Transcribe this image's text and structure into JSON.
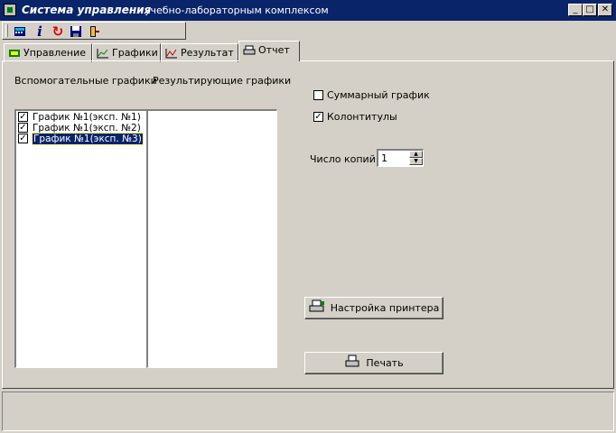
{
  "window": {
    "title_main": "Система управления",
    "title_sub": "учебно-лабораторным комплексом",
    "controls": {
      "minimize": "_",
      "maximize": "□",
      "close": "✕"
    }
  },
  "toolbar": {
    "buttons": [
      {
        "icon": "calculator-icon"
      },
      {
        "icon": "info-icon",
        "glyph": "i"
      },
      {
        "icon": "refresh-icon",
        "glyph": "↻"
      },
      {
        "icon": "save-icon"
      },
      {
        "icon": "exit-icon"
      }
    ]
  },
  "tabs": [
    {
      "label": "Управление",
      "icon": "control-icon"
    },
    {
      "label": "Графики",
      "icon": "chart-icon"
    },
    {
      "label": "Результат",
      "icon": "result-chart-icon"
    },
    {
      "label": "Отчет",
      "icon": "printer-icon",
      "active": true
    }
  ],
  "report": {
    "aux_label": "Вспомогательные графики",
    "result_label": "Результирующие графики",
    "aux_items": [
      {
        "label": "График №1(эксп. №1)",
        "checked": true
      },
      {
        "label": "График №1(эксп. №2)",
        "checked": true
      },
      {
        "label": "График №1(эксп. №3)",
        "checked": true,
        "selected": true
      }
    ],
    "summary_label": "Суммарный график",
    "summary_checked": false,
    "headers_label": "Колонтитулы",
    "headers_checked": true,
    "copies_label": "Число копий",
    "copies_value": "1",
    "printer_setup_label": "Настройка принтера",
    "print_label": "Печать"
  }
}
